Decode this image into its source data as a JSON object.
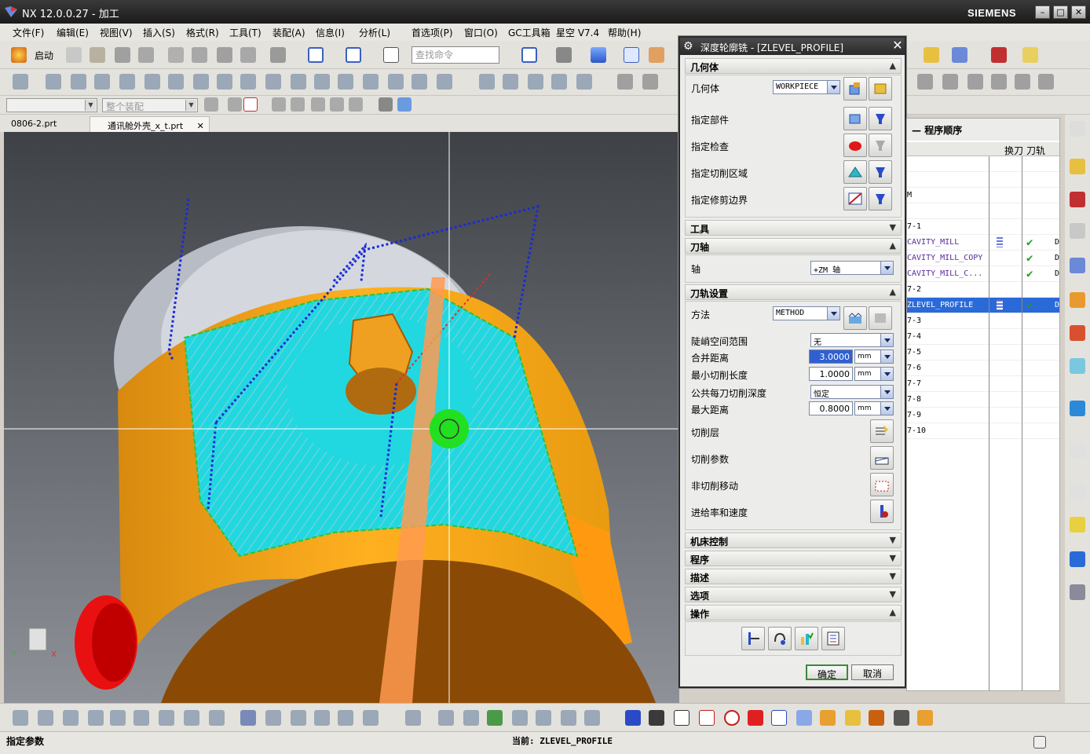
{
  "window": {
    "title": "NX 12.0.0.27 - 加工",
    "brand": "SIEMENS",
    "minimize": "–",
    "maximize": "□",
    "close": "✕"
  },
  "menu": [
    "文件(F)",
    "编辑(E)",
    "视图(V)",
    "插入(S)",
    "格式(R)",
    "工具(T)",
    "装配(A)",
    "信息(I)",
    "分析(L)",
    "首选项(P)",
    "窗口(O)",
    "GC工具箱",
    "星空 V7.4",
    "帮助(H)"
  ],
  "toolbar": {
    "start_label": "启动",
    "search_placeholder": "查找命令",
    "assembly_combo": "整个装配"
  },
  "file_tabs": [
    {
      "label": "0806-2.prt"
    },
    {
      "label": "通讯舱外壳_x_t.prt"
    }
  ],
  "dialog": {
    "title": "深度轮廓铣 - [ZLEVEL_PROFILE]",
    "sections": {
      "geometry": {
        "header": "几何体",
        "geometry_label": "几何体",
        "geometry_value": "WORKPIECE",
        "specify_part": "指定部件",
        "specify_check": "指定检查",
        "specify_cut_area": "指定切削区域",
        "specify_trim": "指定修剪边界"
      },
      "tool": {
        "header": "工具"
      },
      "axis": {
        "header": "刀轴",
        "axis_label": "轴",
        "axis_value": "+ZM 轴"
      },
      "path": {
        "header": "刀轨设置",
        "method_label": "方法",
        "method_value": "METHOD",
        "steep_label": "陡峭空间范围",
        "steep_value": "无",
        "merge_label": "合并距离",
        "merge_value": "3.0000",
        "mincut_label": "最小切削长度",
        "mincut_value": "1.0000",
        "depth_label": "公共每刀切削深度",
        "depth_value": "恒定",
        "maxdist_label": "最大距离",
        "maxdist_value": "0.8000",
        "unit": "mm",
        "cut_levels": "切削层",
        "cut_params": "切削参数",
        "non_cut": "非切削移动",
        "feeds": "进给率和速度"
      },
      "machine": {
        "header": "机床控制"
      },
      "program": {
        "header": "程序"
      },
      "description": {
        "header": "描述"
      },
      "options": {
        "header": "选项"
      },
      "actions": {
        "header": "操作"
      }
    },
    "ok": "确定",
    "cancel": "取消"
  },
  "navigator": {
    "title": "程序顺序",
    "col_toolchange": "换刀",
    "col_path": "刀轨",
    "rows": [
      {
        "name": "",
        "chk": false,
        "sel": false
      },
      {
        "name": "",
        "chk": false,
        "sel": false
      },
      {
        "name": "M",
        "chk": false,
        "sel": false
      },
      {
        "name": "",
        "chk": false,
        "sel": false
      },
      {
        "name": "7-1",
        "chk": false,
        "sel": false
      },
      {
        "name": "CAVITY_MILL",
        "chk": true,
        "sel": false,
        "tool": true,
        "tail": "D"
      },
      {
        "name": "CAVITY_MILL_COPY",
        "chk": true,
        "sel": false,
        "tail": "D"
      },
      {
        "name": "CAVITY_MILL_C...",
        "chk": true,
        "sel": false,
        "tail": "D"
      },
      {
        "name": "7-2",
        "chk": false,
        "sel": false
      },
      {
        "name": "ZLEVEL_PROFILE",
        "chk": true,
        "sel": true,
        "tool": true,
        "tail": "D"
      },
      {
        "name": "7-3",
        "chk": false,
        "sel": false
      },
      {
        "name": "7-4",
        "chk": false,
        "sel": false
      },
      {
        "name": "7-5",
        "chk": false,
        "sel": false
      },
      {
        "name": "7-6",
        "chk": false,
        "sel": false
      },
      {
        "name": "7-7",
        "chk": false,
        "sel": false
      },
      {
        "name": "7-8",
        "chk": false,
        "sel": false
      },
      {
        "name": "7-9",
        "chk": false,
        "sel": false
      },
      {
        "name": "7-10",
        "chk": false,
        "sel": false
      }
    ]
  },
  "status": {
    "left": "指定参数",
    "current": "当前: ZLEVEL_PROFILE"
  },
  "viewport": {
    "axis_label_y": "Y",
    "axis_label_x": "X"
  }
}
